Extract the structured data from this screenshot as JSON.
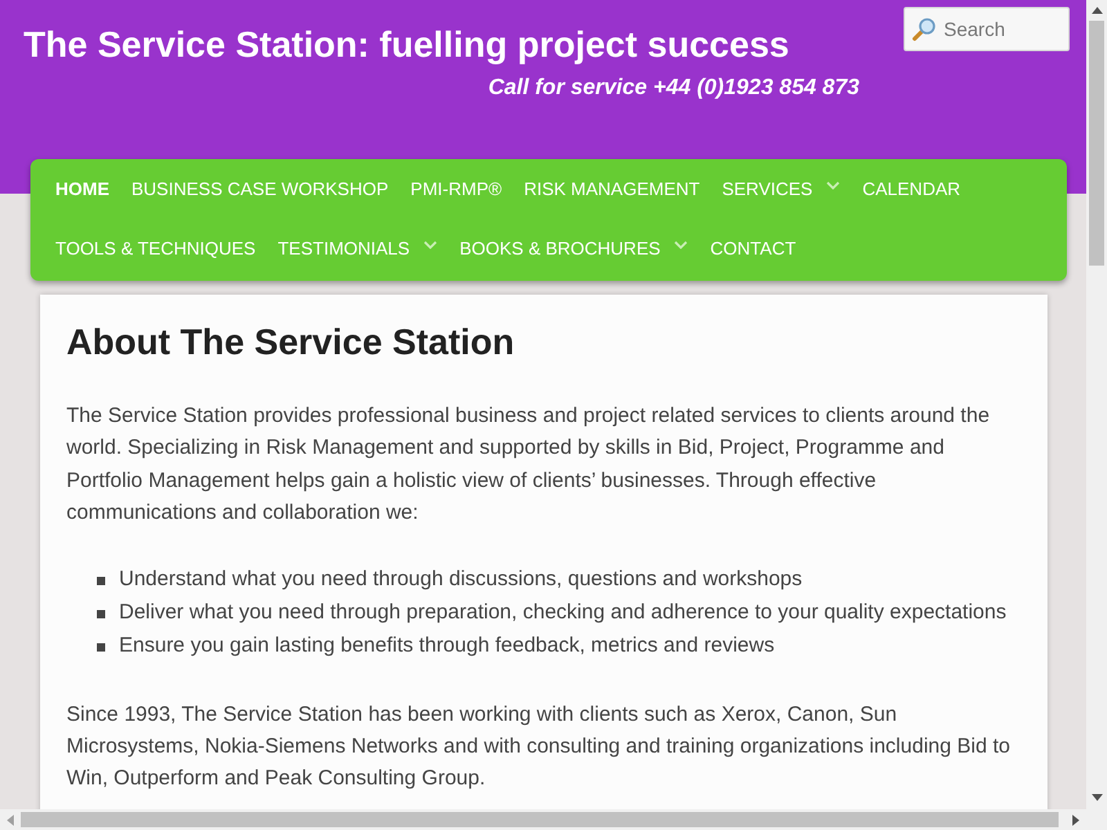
{
  "header": {
    "title": "The Service Station: fuelling project success",
    "phone": "Call for service +44 (0)1923 854 873",
    "search": {
      "placeholder": "Search"
    }
  },
  "nav": {
    "rows": [
      {
        "items": [
          {
            "label": "HOME",
            "selected": true,
            "submenu": false
          },
          {
            "label": "BUSINESS CASE WORKSHOP",
            "selected": false,
            "submenu": false
          },
          {
            "label": "PMI-RMP®",
            "selected": false,
            "submenu": false
          },
          {
            "label": "RISK MANAGEMENT",
            "selected": false,
            "submenu": false
          },
          {
            "label": "SERVICES",
            "selected": false,
            "submenu": true
          },
          {
            "label": "CALENDAR",
            "selected": false,
            "submenu": false
          }
        ]
      },
      {
        "items": [
          {
            "label": "TOOLS & TECHNIQUES",
            "selected": false,
            "submenu": false
          },
          {
            "label": "TESTIMONIALS",
            "selected": false,
            "submenu": true
          },
          {
            "label": "BOOKS & BROCHURES",
            "selected": false,
            "submenu": true
          },
          {
            "label": "CONTACT",
            "selected": false,
            "submenu": false
          }
        ]
      }
    ]
  },
  "content": {
    "heading": "About The Service Station",
    "blocks": [
      {
        "kind": "paragraph",
        "text": "The Service Station provides professional business and project related services to clients around the world. Specializing in Risk Management and supported by skills in Bid, Project, Programme and Portfolio Management helps gain a holistic view of clients’ businesses. Through effective communications and collaboration we:"
      },
      {
        "kind": "list",
        "items": [
          "Understand what you need through discussions, questions and workshops",
          "Deliver what you need through preparation, checking and adherence to your quality expectations",
          "Ensure you gain lasting benefits through feedback, metrics and reviews"
        ]
      },
      {
        "kind": "paragraph",
        "text": "Since 1993, The Service Station has been working with clients such as Xerox, Canon, Sun Microsystems, Nokia-Siemens Networks and with consulting and training organizations including Bid to Win, Outperform and Peak Consulting Group."
      }
    ]
  }
}
